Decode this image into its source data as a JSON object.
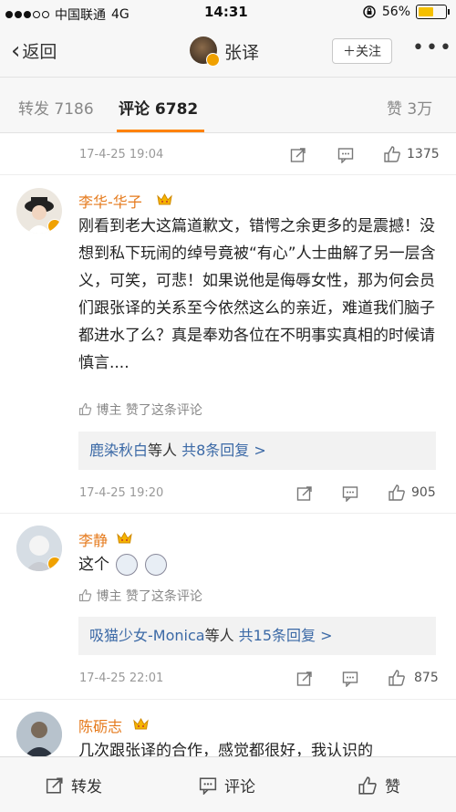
{
  "status_bar": {
    "carrier": "中国联通",
    "network": "4G",
    "time": "14:31",
    "battery": "56%",
    "battery_level": 0.56
  },
  "nav": {
    "back_label": "返回",
    "title": "张译",
    "follow_label": "＋关注"
  },
  "tabs": {
    "repost": "转发 7186",
    "comment": "评论 6782",
    "like": "赞 3万"
  },
  "top_partial": {
    "time": "17-4-25 19:04",
    "like_count": "1375"
  },
  "comments": [
    {
      "user": "李华-华子",
      "text": "刚看到老大这篇道歉文，错愕之余更多的是震撼！没想到私下玩闹的绰号竟被“有心”人士曲解了另一层含义，可笑，可悲！如果说他是侮辱女性，那为何会员们跟张译的关系至今依然这么的亲近，难道我们脑子都进水了么？真是奉劝各位在不明事实真相的时候请慎言....",
      "liked_by": "博主 赞了这条评论",
      "reply_names": "鹿染秋白",
      "reply_suffix": "等人",
      "reply_count": "共8条回复 >",
      "time": "17-4-25 19:20",
      "like_count": "905"
    },
    {
      "user": "李静",
      "text": "这个",
      "liked_by": "博主 赞了这条评论",
      "reply_names": "吸猫少女-Monica",
      "reply_suffix": "等人",
      "reply_count": "共15条回复 >",
      "time": "17-4-25 22:01",
      "like_count": "875"
    },
    {
      "user": "陈砺志",
      "text": "几次跟张译的合作，感觉都很好，我认识的"
    }
  ],
  "bottom_bar": {
    "repost": "转发",
    "comment": "评论",
    "like": "赞"
  },
  "colors": {
    "accent": "#ff8200",
    "username": "#e57a1c",
    "link": "#3b69a6"
  }
}
